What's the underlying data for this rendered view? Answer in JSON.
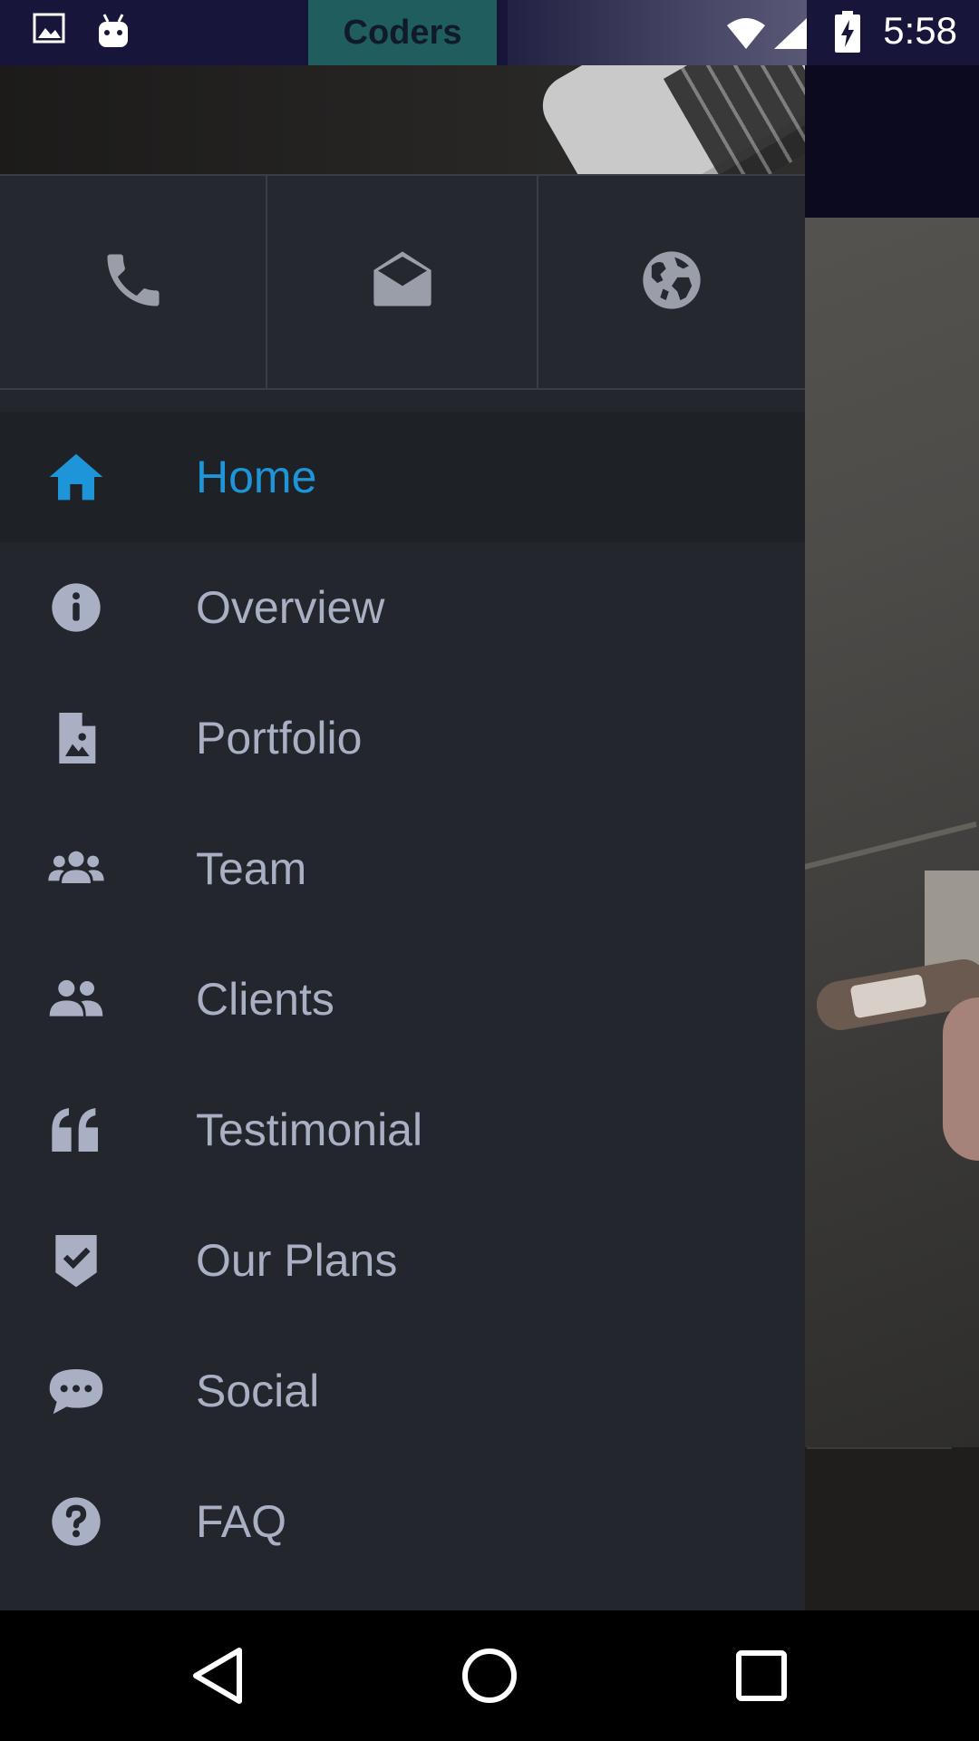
{
  "status_bar": {
    "time": "5:58",
    "app_chip_label": "Coders",
    "icons": [
      "image-icon",
      "android-icon",
      "wifi-icon",
      "signal-icon",
      "battery-charging-icon"
    ]
  },
  "drawer": {
    "contact_actions": [
      {
        "name": "phone-icon"
      },
      {
        "name": "mail-open-icon"
      },
      {
        "name": "globe-icon"
      }
    ],
    "menu": [
      {
        "label": "Home",
        "icon": "home-icon",
        "active": true
      },
      {
        "label": "Overview",
        "icon": "info-icon"
      },
      {
        "label": "Portfolio",
        "icon": "file-image-icon"
      },
      {
        "label": "Team",
        "icon": "group-icon"
      },
      {
        "label": "Clients",
        "icon": "people-icon"
      },
      {
        "label": "Testimonial",
        "icon": "quote-icon"
      },
      {
        "label": "Our Plans",
        "icon": "badge-check-icon"
      },
      {
        "label": "Social",
        "icon": "chat-icon"
      },
      {
        "label": "FAQ",
        "icon": "question-icon"
      }
    ],
    "colors": {
      "active": "#1e95d8",
      "inactive": "#aab0c4",
      "background": "#23262c"
    }
  },
  "nav_bar": {
    "buttons": [
      "back-icon",
      "home-circle-icon",
      "recents-icon"
    ]
  }
}
